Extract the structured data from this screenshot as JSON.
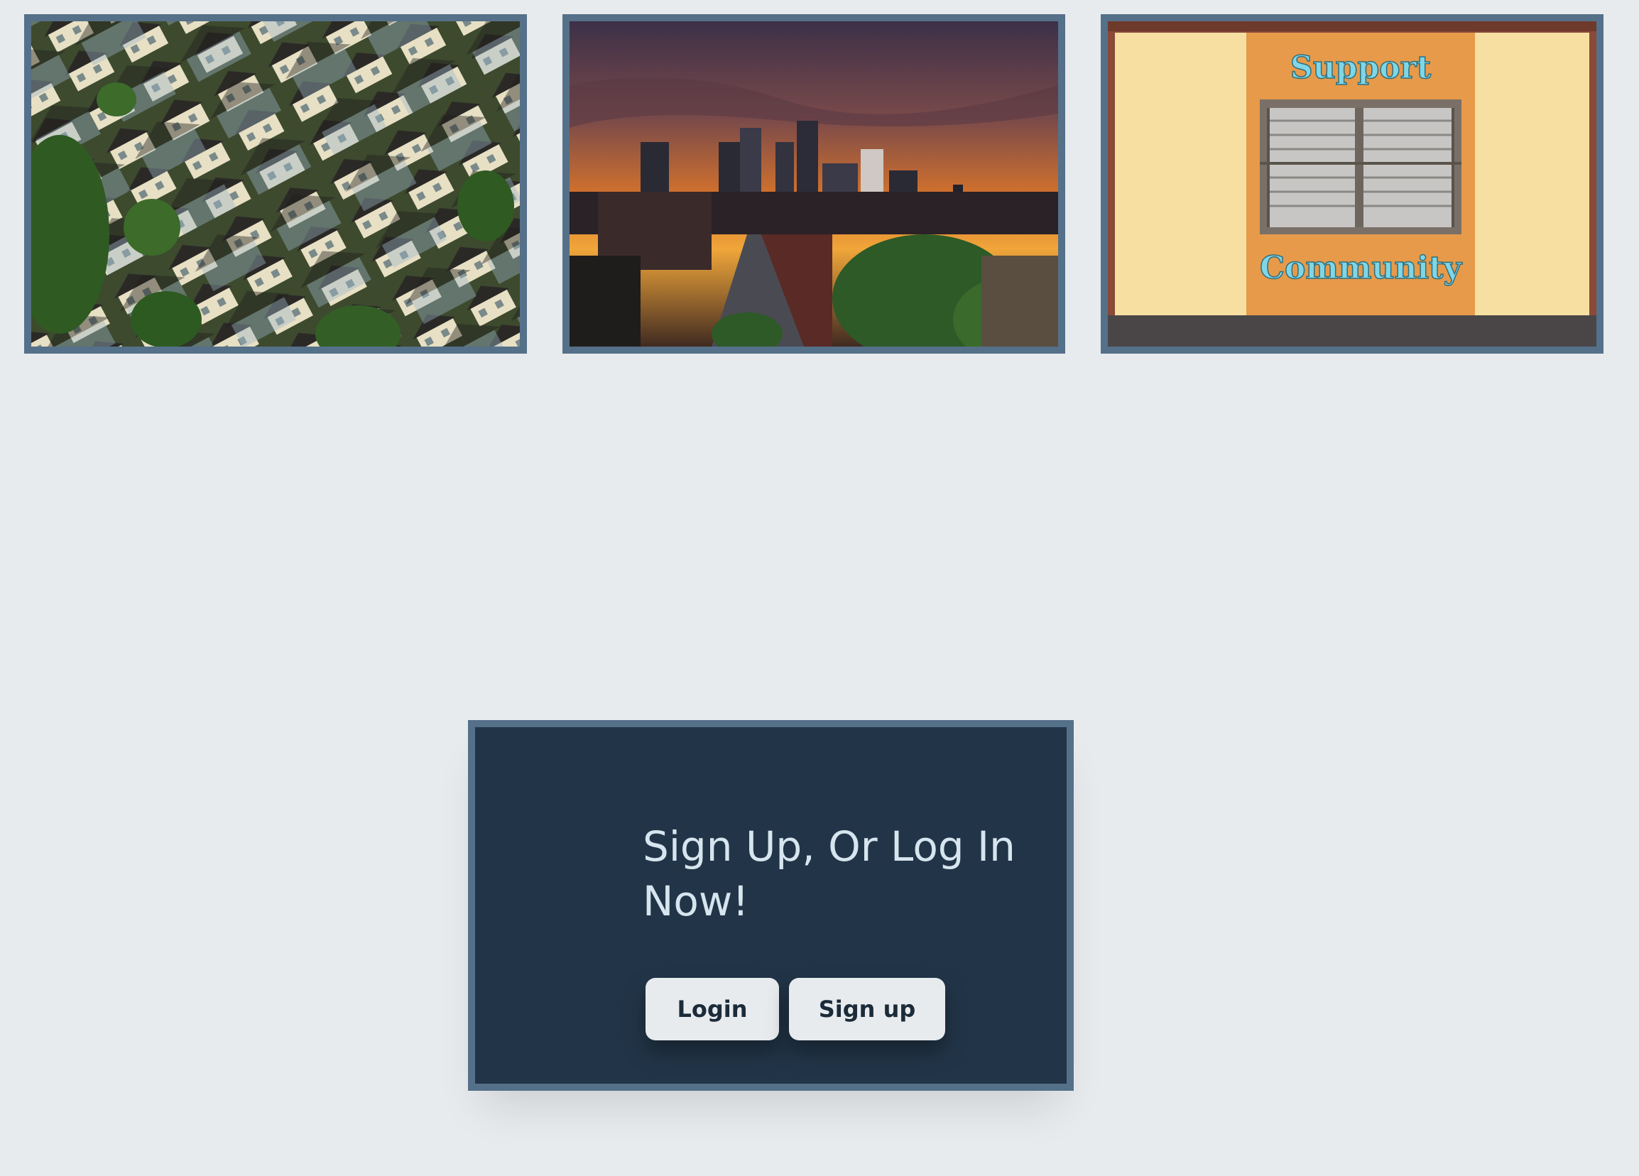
{
  "gallery": {
    "images": [
      {
        "alt": "aerial view of houses",
        "icon": "houses-photo"
      },
      {
        "alt": "city skyline at sunset",
        "icon": "skyline-photo"
      },
      {
        "alt": "Support Community wall",
        "icon": "community-photo",
        "sign_top": "Support",
        "sign_bottom": "Community"
      }
    ]
  },
  "cta": {
    "title": "Sign Up, Or Log In Now!",
    "login_label": "Login",
    "signup_label": "Sign up"
  },
  "colors": {
    "background": "#e8ebee",
    "frame": "#557089",
    "panel": "#223548",
    "title_text": "#d6e5ee",
    "button_bg": "#e8ebee",
    "button_text": "#1b2b3a"
  }
}
